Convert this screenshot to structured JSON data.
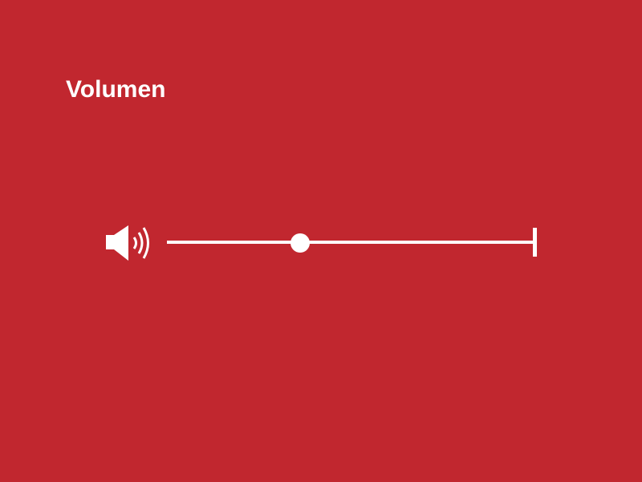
{
  "header": {
    "title": "Volumen"
  },
  "volume": {
    "icon": "speaker-volume-icon",
    "value": 0.36,
    "min": 0,
    "max": 1
  },
  "colors": {
    "background": "#c1272f",
    "foreground": "#ffffff"
  }
}
